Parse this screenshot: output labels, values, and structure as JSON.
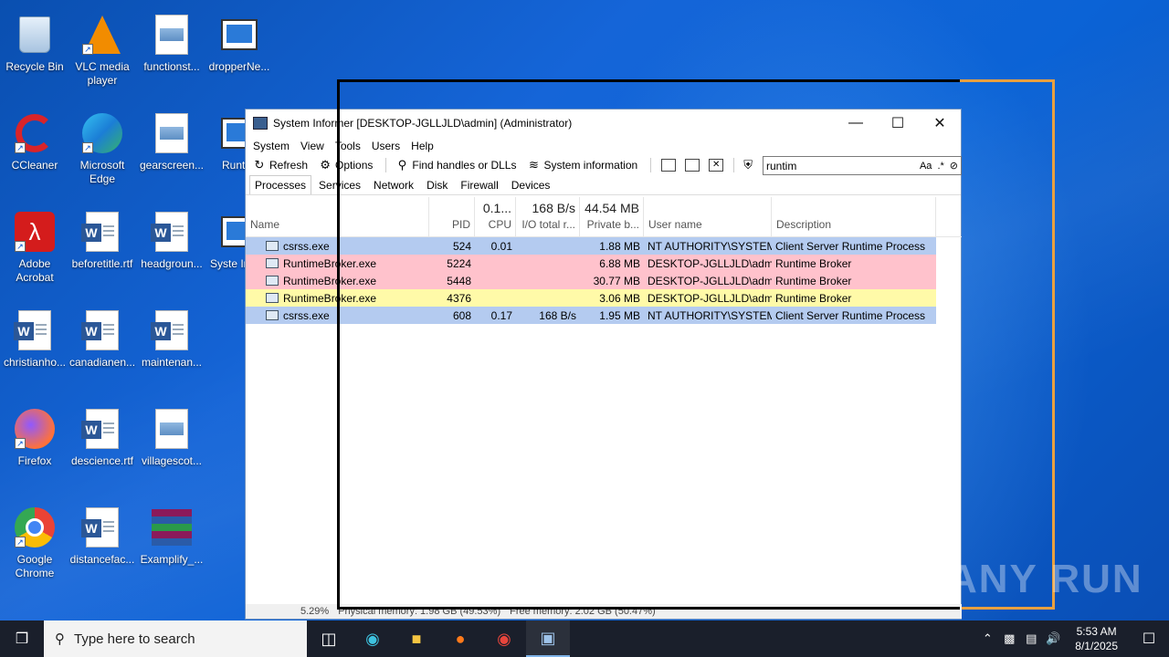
{
  "desktop": {
    "icons": [
      {
        "label": "Recycle Bin"
      },
      {
        "label": "VLC media player"
      },
      {
        "label": "functionst..."
      },
      {
        "label": "dropperNe..."
      },
      {
        "label": "CCleaner"
      },
      {
        "label": "Microsoft Edge"
      },
      {
        "label": "gearscreen..."
      },
      {
        "label": "Runtim"
      },
      {
        "label": "Adobe Acrobat"
      },
      {
        "label": "beforetitle.rtf"
      },
      {
        "label": "headgroun..."
      },
      {
        "label": "Syste Inforn"
      },
      {
        "label": "christianho..."
      },
      {
        "label": "canadianen..."
      },
      {
        "label": "maintenan..."
      },
      {
        "label": "Firefox"
      },
      {
        "label": "descience.rtf"
      },
      {
        "label": "villagescot..."
      },
      {
        "label": "Google Chrome"
      },
      {
        "label": "distancefac..."
      },
      {
        "label": "Examplify_..."
      }
    ]
  },
  "window": {
    "title": "System Informer [DESKTOP-JGLLJLD\\admin] (Administrator)",
    "menu": [
      "System",
      "View",
      "Tools",
      "Users",
      "Help"
    ],
    "toolbar": {
      "refresh": "Refresh",
      "options": "Options",
      "find_handles": "Find handles or DLLs",
      "system_info": "System information"
    },
    "search": {
      "value": "runtim",
      "case_label": "Aa",
      "regex_label": ".*"
    },
    "tabs": [
      "Processes",
      "Services",
      "Network",
      "Disk",
      "Firewall",
      "Devices"
    ],
    "columns": {
      "name": "Name",
      "pid": "PID",
      "cpu": "CPU",
      "cpu_total": "0.1...",
      "io": "I/O total r...",
      "io_total": "168 B/s",
      "private": "Private b...",
      "private_total": "44.54 MB",
      "user": "User name",
      "desc": "Description"
    },
    "rows": [
      {
        "name": "csrss.exe",
        "pid": "524",
        "cpu": "0.01",
        "io": "",
        "private": "1.88 MB",
        "user": "NT AUTHORITY\\SYSTEM",
        "desc": "Client Server Runtime Process",
        "color": "#b4cbf0"
      },
      {
        "name": "RuntimeBroker.exe",
        "pid": "5224",
        "cpu": "",
        "io": "",
        "private": "6.88 MB",
        "user": "DESKTOP-JGLLJLD\\admi",
        "desc": "Runtime Broker",
        "color": "#ffc2cc"
      },
      {
        "name": "RuntimeBroker.exe",
        "pid": "5448",
        "cpu": "",
        "io": "",
        "private": "30.77 MB",
        "user": "DESKTOP-JGLLJLD\\admi",
        "desc": "Runtime Broker",
        "color": "#ffc2cc"
      },
      {
        "name": "RuntimeBroker.exe",
        "pid": "4376",
        "cpu": "",
        "io": "",
        "private": "3.06 MB",
        "user": "DESKTOP-JGLLJLD\\admi",
        "desc": "Runtime Broker",
        "color": "#fffaa8"
      },
      {
        "name": "csrss.exe",
        "pid": "608",
        "cpu": "0.17",
        "io": "168 B/s",
        "private": "1.95 MB",
        "user": "NT AUTHORITY\\SYSTEM",
        "desc": "Client Server Runtime Process",
        "color": "#b4cbf0"
      }
    ],
    "status": {
      "cpu": "5.29%",
      "physical": "Physical memory: 1.98 GB (49.53%)",
      "free": "Free memory: 2.02 GB (50.47%)"
    }
  },
  "taskbar": {
    "search_placeholder": "Type here to search",
    "time": "5:53 AM",
    "date": "8/1/2025"
  },
  "watermark": "ANY RUN"
}
